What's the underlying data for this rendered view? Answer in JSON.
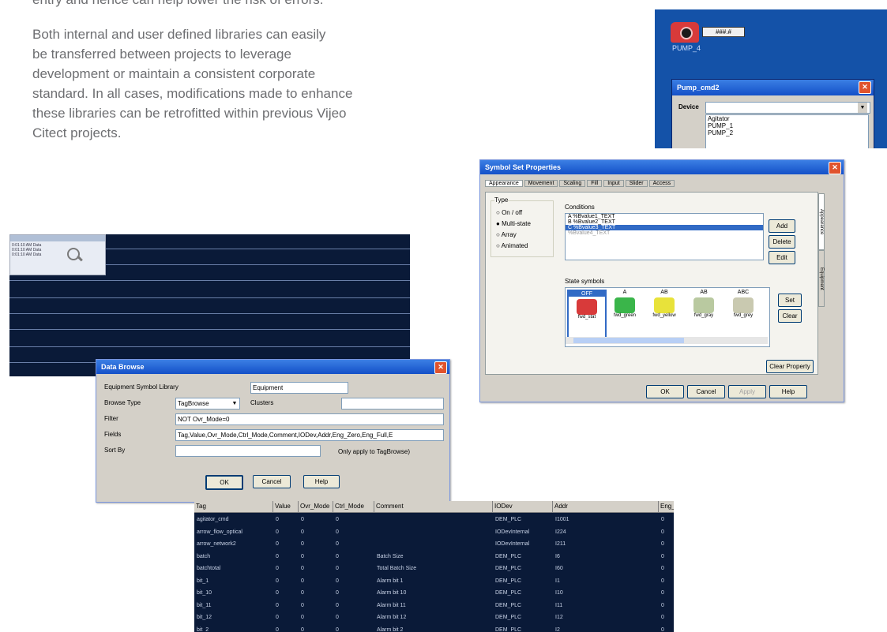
{
  "intro_fragment": "entry and hence can help lower the risk of errors.",
  "paragraph_lines": [
    "Both internal and user defined libraries can easily",
    "be transferred between projects to leverage",
    "development or maintain a consistent corporate",
    "standard. In all cases, modifications made to enhance",
    "these libraries can be retrofitted within previous Vijeo",
    "Citect projects."
  ],
  "pump_panel": {
    "tag_value": "###.#",
    "pump_label": "PUMP_4",
    "dialog_title": "Pump_cmd2",
    "device_label": "Device",
    "list_items": [
      "Agitator",
      "PUMP_1",
      "PUMP_2"
    ]
  },
  "symbol_dialog": {
    "title": "Symbol Set Properties",
    "tabs": [
      "Appearance",
      "Movement",
      "Scaling",
      "Fill",
      "Input",
      "Slider",
      "Access"
    ],
    "type_label": "Type",
    "type_options": [
      "On / off",
      "Multi-state",
      "Array",
      "Animated"
    ],
    "conditions_label": "Conditions",
    "condition_items": [
      "A  %Bvalue1_TEXT",
      "B  %Bvalue2_TEXT",
      "C  %Bvalue3_TEXT",
      "%Bvalue4_TEXT"
    ],
    "side_buttons": [
      "Add",
      "Delete",
      "Edit"
    ],
    "state_label": "State symbols",
    "state_headers": [
      "OFF",
      "A",
      "AB",
      "AB",
      "ABC"
    ],
    "state_captions": [
      "fwd_stat",
      "fwd_green",
      "fwd_yellow",
      "fwd_gray",
      "fwd_grey"
    ],
    "set_buttons": [
      "Set",
      "Clear"
    ],
    "clear_props": "Clear Property",
    "bottom_buttons": [
      "OK",
      "Cancel",
      "Apply",
      "Help"
    ],
    "vtabs": [
      "Appearance",
      "Equipment"
    ]
  },
  "data_browse": {
    "title": "Data Browse",
    "rows": [
      {
        "label": "Equipment Symbol Library",
        "value": "Equipment"
      },
      {
        "label": "Browse Type",
        "value": "TagBrowse"
      },
      {
        "label": "Filter",
        "value": "NOT Ovr_Mode=0"
      },
      {
        "label": "Fields",
        "value": "Tag,Value,Ovr_Mode,Ctrl_Mode,Comment,IODev,Addr,Eng_Zero,Eng_Full,E"
      },
      {
        "label": "Sort By",
        "value": ""
      }
    ],
    "clusters_label": "Clusters",
    "apply_note": "Only apply to TagBrowse)",
    "buttons": [
      "OK",
      "Cancel",
      "Help"
    ]
  },
  "tag_grid": {
    "columns": [
      "Tag",
      "Value",
      "Ovr_Mode",
      "Ctrl_Mode",
      "Comment",
      "IODev",
      "Addr",
      "Eng_Zero"
    ],
    "rows": [
      [
        "agitator_cmd",
        "0",
        "0",
        "0",
        "",
        "DEM_PLC",
        "I1001",
        "0"
      ],
      [
        "arrow_flow_optical",
        "0",
        "0",
        "0",
        "",
        "IODevInternal",
        "I224",
        "0"
      ],
      [
        "arrow_network2",
        "0",
        "0",
        "0",
        "",
        "IODevInternal",
        "I211",
        "0"
      ],
      [
        "batch",
        "0",
        "0",
        "0",
        "Batch Size",
        "DEM_PLC",
        "I6",
        "0"
      ],
      [
        "batchtotal",
        "0",
        "0",
        "0",
        "Total Batch Size",
        "DEM_PLC",
        "I60",
        "0"
      ],
      [
        "bit_1",
        "0",
        "0",
        "0",
        "Alarm bit 1",
        "DEM_PLC",
        "I1",
        "0"
      ],
      [
        "bit_10",
        "0",
        "0",
        "0",
        "Alarm bit 10",
        "DEM_PLC",
        "I10",
        "0"
      ],
      [
        "bit_11",
        "0",
        "0",
        "0",
        "Alarm bit 11",
        "DEM_PLC",
        "I11",
        "0"
      ],
      [
        "bit_12",
        "0",
        "0",
        "0",
        "Alarm bit 12",
        "DEM_PLC",
        "I12",
        "0"
      ],
      [
        "bit_2",
        "0",
        "0",
        "0",
        "Alarm bit 2",
        "DEM_PLC",
        "I2",
        "0"
      ]
    ]
  },
  "mini_table": {
    "cells": [
      [
        "0:01:10 AM",
        "Data"
      ],
      [
        "0:01:10 AM",
        "Data"
      ],
      [
        "0:01:10 AM",
        "Data"
      ]
    ]
  },
  "colors": {
    "text_gray": "#6d6e71",
    "navy": "#0a1a38",
    "desktop_blue": "#1452a8",
    "xp_title": "#1450c8"
  }
}
